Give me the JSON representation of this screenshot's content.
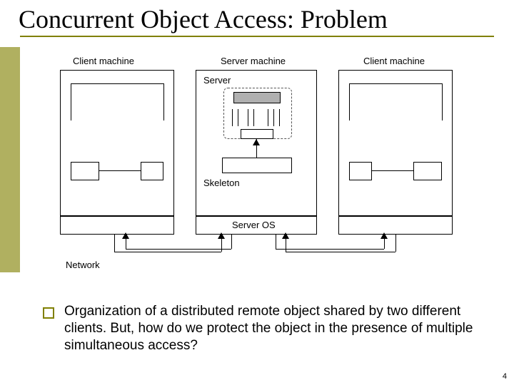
{
  "title": "Concurrent Object Access: Problem",
  "diagram": {
    "label_client_left": "Client machine",
    "label_server_machine": "Server machine",
    "label_client_right": "Client machine",
    "label_server": "Server",
    "label_skeleton": "Skeleton",
    "label_server_os": "Server OS",
    "label_network": "Network"
  },
  "bullet": "Organization of a distributed remote object shared by two different clients. But, how do we protect the object in the presence of multiple simultaneous access?",
  "page_number": "4"
}
